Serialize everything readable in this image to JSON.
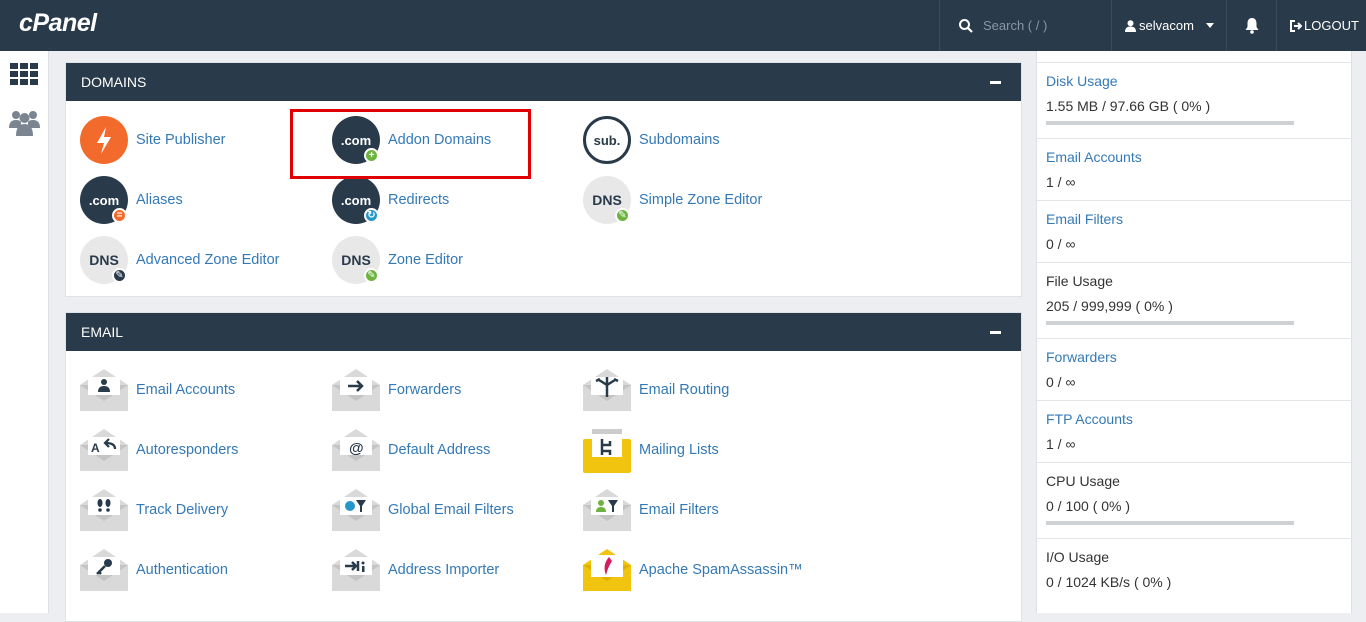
{
  "app": {
    "logo": "cPanel",
    "search_placeholder": "Search ( / )",
    "username": "selvacom",
    "logout_label": "LOGOUT"
  },
  "domains": {
    "title": "DOMAINS",
    "items": [
      {
        "label": "Site Publisher"
      },
      {
        "label": "Addon Domains"
      },
      {
        "label": "Subdomains"
      },
      {
        "label": "Aliases"
      },
      {
        "label": "Redirects"
      },
      {
        "label": "Simple Zone Editor"
      },
      {
        "label": "Advanced Zone Editor"
      },
      {
        "label": "Zone Editor"
      }
    ],
    "icon_text": {
      "com": ".com",
      "sub": "sub.",
      "dns": "DNS"
    }
  },
  "email": {
    "title": "EMAIL",
    "items": [
      {
        "label": "Email Accounts"
      },
      {
        "label": "Forwarders"
      },
      {
        "label": "Email Routing"
      },
      {
        "label": "Autoresponders"
      },
      {
        "label": "Default Address"
      },
      {
        "label": "Mailing Lists"
      },
      {
        "label": "Track Delivery"
      },
      {
        "label": "Global Email Filters"
      },
      {
        "label": "Email Filters"
      },
      {
        "label": "Authentication"
      },
      {
        "label": "Address Importer"
      },
      {
        "label": "Apache SpamAssassin™"
      }
    ]
  },
  "stats": [
    {
      "title": "Disk Usage",
      "value": "1.55 MB / 97.66 GB ( 0% )",
      "fraction": 0
    },
    {
      "title": "Email Accounts",
      "value": "1 / ∞"
    },
    {
      "title": "Email Filters",
      "value": "0 / ∞"
    },
    {
      "title": "File Usage",
      "value": "205 / 999,999 ( 0% )",
      "fraction": 0
    },
    {
      "title": "Forwarders",
      "value": "0 / ∞"
    },
    {
      "title": "FTP Accounts",
      "value": "1 / ∞"
    },
    {
      "title": "CPU Usage",
      "value": "0 / 100 ( 0% )",
      "fraction": 0
    },
    {
      "title": "I/O Usage",
      "value": "0 / 1024 KB/s ( 0% )",
      "fraction": 0
    }
  ],
  "colors": {
    "header_bg": "#293a4a",
    "link": "#3479b7",
    "highlight_box": "#e00000",
    "orange": "#f26a2c",
    "green_badge": "#6db33f"
  }
}
